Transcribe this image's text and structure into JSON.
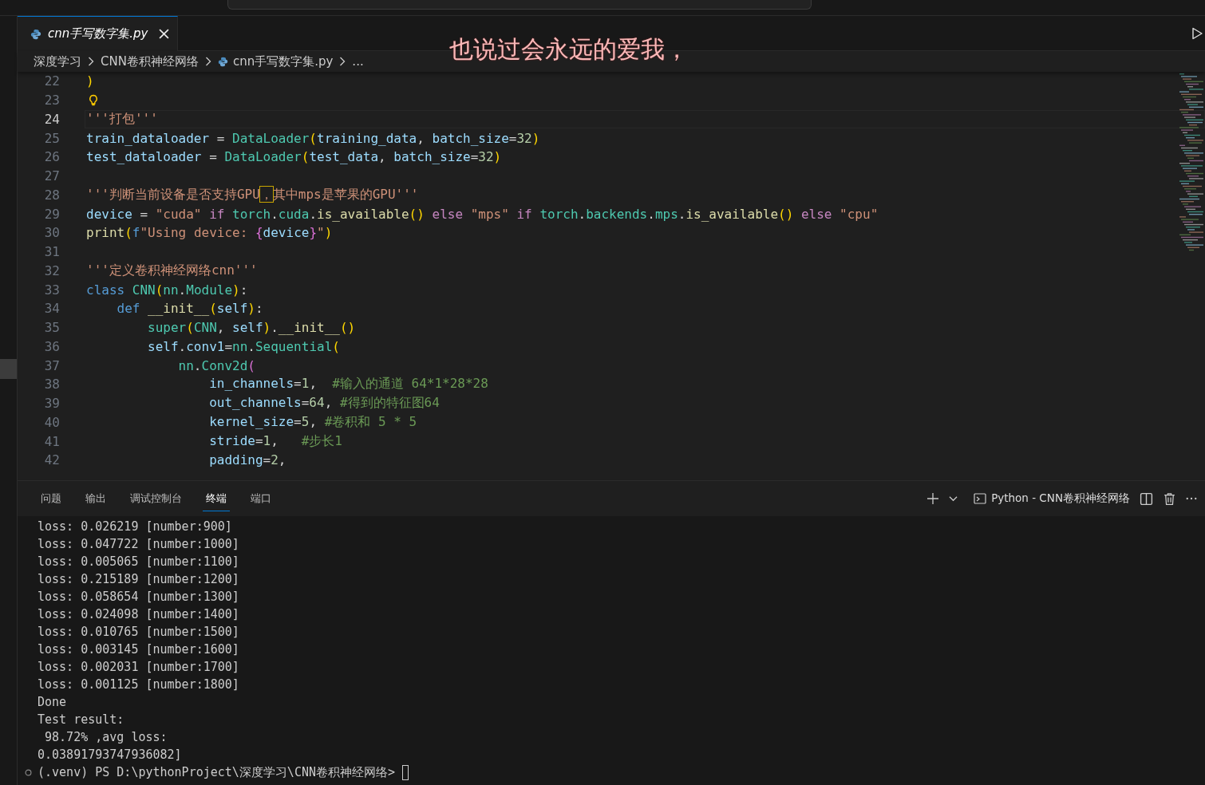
{
  "tab": {
    "label": "cnn手写数字集.py",
    "selected": true
  },
  "breadcrumb": [
    "深度学习",
    "CNN卷积神经网络",
    "cnn手写数字集.py",
    "..."
  ],
  "overlay_lyric": "也说过会永远的爱我，",
  "lines": [
    {
      "number": "22",
      "current": false,
      "tokens": [
        {
          "kind": "brk1",
          "text": ")"
        }
      ]
    },
    {
      "number": "23",
      "current": false,
      "tokens": [
        {
          "kind": "lightbulb"
        }
      ]
    },
    {
      "number": "24",
      "current": true,
      "tokens": [
        {
          "kind": "str",
          "text": "'''打包'''"
        }
      ]
    },
    {
      "number": "25",
      "current": false,
      "tokens": [
        {
          "kind": "var",
          "text": "train_dataloader"
        },
        {
          "kind": "plain",
          "text": " = "
        },
        {
          "kind": "cls",
          "text": "DataLoader"
        },
        {
          "kind": "brk1",
          "text": "("
        },
        {
          "kind": "var",
          "text": "training_data"
        },
        {
          "kind": "plain",
          "text": ", "
        },
        {
          "kind": "var",
          "text": "batch_size"
        },
        {
          "kind": "plain",
          "text": "="
        },
        {
          "kind": "num",
          "text": "32"
        },
        {
          "kind": "brk1",
          "text": ")"
        }
      ]
    },
    {
      "number": "26",
      "current": false,
      "tokens": [
        {
          "kind": "var",
          "text": "test_dataloader"
        },
        {
          "kind": "plain",
          "text": " = "
        },
        {
          "kind": "cls",
          "text": "DataLoader"
        },
        {
          "kind": "brk1",
          "text": "("
        },
        {
          "kind": "var",
          "text": "test_data"
        },
        {
          "kind": "plain",
          "text": ", "
        },
        {
          "kind": "var",
          "text": "batch_size"
        },
        {
          "kind": "plain",
          "text": "="
        },
        {
          "kind": "num",
          "text": "32"
        },
        {
          "kind": "brk1",
          "text": ")"
        }
      ]
    },
    {
      "number": "27",
      "current": false
    },
    {
      "number": "28",
      "current": false,
      "tokens": [
        {
          "kind": "str",
          "text": "'''判断当前设备是否支持GPU"
        },
        {
          "kind": "flagged",
          "text": "，"
        },
        {
          "kind": "str",
          "text": "其中mps是苹果的GPU'''"
        }
      ]
    },
    {
      "number": "29",
      "current": false,
      "tokens": [
        {
          "kind": "var",
          "text": "device"
        },
        {
          "kind": "plain",
          "text": " = "
        },
        {
          "kind": "str",
          "text": "\"cuda\""
        },
        {
          "kind": "ctrl",
          "text": " if "
        },
        {
          "kind": "cls",
          "text": "torch"
        },
        {
          "kind": "plain",
          "text": "."
        },
        {
          "kind": "cls",
          "text": "cuda"
        },
        {
          "kind": "plain",
          "text": "."
        },
        {
          "kind": "fn",
          "text": "is_available"
        },
        {
          "kind": "brk1",
          "text": "()"
        },
        {
          "kind": "ctrl",
          "text": " else "
        },
        {
          "kind": "str",
          "text": "\"mps\""
        },
        {
          "kind": "ctrl",
          "text": " if "
        },
        {
          "kind": "cls",
          "text": "torch"
        },
        {
          "kind": "plain",
          "text": "."
        },
        {
          "kind": "cls",
          "text": "backends"
        },
        {
          "kind": "plain",
          "text": "."
        },
        {
          "kind": "cls",
          "text": "mps"
        },
        {
          "kind": "plain",
          "text": "."
        },
        {
          "kind": "fn",
          "text": "is_available"
        },
        {
          "kind": "brk1",
          "text": "()"
        },
        {
          "kind": "ctrl",
          "text": " else "
        },
        {
          "kind": "str",
          "text": "\"cpu\""
        }
      ]
    },
    {
      "number": "30",
      "current": false,
      "tokens": [
        {
          "kind": "fn",
          "text": "print"
        },
        {
          "kind": "brk1",
          "text": "("
        },
        {
          "kind": "kw",
          "text": "f"
        },
        {
          "kind": "str",
          "text": "\"Using device: "
        },
        {
          "kind": "brk2",
          "text": "{"
        },
        {
          "kind": "var",
          "text": "device"
        },
        {
          "kind": "brk2",
          "text": "}"
        },
        {
          "kind": "str",
          "text": "\""
        },
        {
          "kind": "brk1",
          "text": ")"
        }
      ]
    },
    {
      "number": "31",
      "current": false
    },
    {
      "number": "32",
      "current": false,
      "tokens": [
        {
          "kind": "str",
          "text": "'''定义卷积神经网络cnn'''"
        }
      ]
    },
    {
      "number": "33",
      "current": false,
      "tokens": [
        {
          "kind": "kw",
          "text": "class "
        },
        {
          "kind": "cls",
          "text": "CNN"
        },
        {
          "kind": "brk1",
          "text": "("
        },
        {
          "kind": "cls",
          "text": "nn"
        },
        {
          "kind": "plain",
          "text": "."
        },
        {
          "kind": "cls",
          "text": "Module"
        },
        {
          "kind": "brk1",
          "text": ")"
        },
        {
          "kind": "plain",
          "text": ":"
        }
      ]
    },
    {
      "number": "34",
      "current": false,
      "tokens": [
        {
          "kind": "kw",
          "text": "    def "
        },
        {
          "kind": "fn",
          "text": "__init__"
        },
        {
          "kind": "brk1",
          "text": "("
        },
        {
          "kind": "var",
          "text": "self"
        },
        {
          "kind": "brk1",
          "text": ")"
        },
        {
          "kind": "plain",
          "text": ":"
        }
      ]
    },
    {
      "number": "35",
      "current": false,
      "tokens": [
        {
          "kind": "cls",
          "text": "        super"
        },
        {
          "kind": "brk1",
          "text": "("
        },
        {
          "kind": "cls",
          "text": "CNN"
        },
        {
          "kind": "plain",
          "text": ", "
        },
        {
          "kind": "var",
          "text": "self"
        },
        {
          "kind": "brk1",
          "text": ")"
        },
        {
          "kind": "plain",
          "text": "."
        },
        {
          "kind": "fn",
          "text": "__init__"
        },
        {
          "kind": "brk1",
          "text": "()"
        }
      ]
    },
    {
      "number": "36",
      "current": false,
      "tokens": [
        {
          "kind": "var",
          "text": "        self"
        },
        {
          "kind": "plain",
          "text": "."
        },
        {
          "kind": "var",
          "text": "conv1"
        },
        {
          "kind": "plain",
          "text": "="
        },
        {
          "kind": "cls",
          "text": "nn"
        },
        {
          "kind": "plain",
          "text": "."
        },
        {
          "kind": "cls",
          "text": "Sequential"
        },
        {
          "kind": "brk1",
          "text": "("
        }
      ]
    },
    {
      "number": "37",
      "current": false,
      "tokens": [
        {
          "kind": "cls",
          "text": "            nn"
        },
        {
          "kind": "plain",
          "text": "."
        },
        {
          "kind": "cls",
          "text": "Conv2d"
        },
        {
          "kind": "brk2",
          "text": "("
        }
      ]
    },
    {
      "number": "38",
      "current": false,
      "tokens": [
        {
          "kind": "var",
          "text": "                in_channels"
        },
        {
          "kind": "plain",
          "text": "="
        },
        {
          "kind": "num",
          "text": "1"
        },
        {
          "kind": "plain",
          "text": ",  "
        },
        {
          "kind": "comment",
          "text": "#输入的通道 64*1*28*28"
        }
      ]
    },
    {
      "number": "39",
      "current": false,
      "tokens": [
        {
          "kind": "var",
          "text": "                out_channels"
        },
        {
          "kind": "plain",
          "text": "="
        },
        {
          "kind": "num",
          "text": "64"
        },
        {
          "kind": "plain",
          "text": ", "
        },
        {
          "kind": "comment",
          "text": "#得到的特征图64"
        }
      ]
    },
    {
      "number": "40",
      "current": false,
      "tokens": [
        {
          "kind": "var",
          "text": "                kernel_size"
        },
        {
          "kind": "plain",
          "text": "="
        },
        {
          "kind": "num",
          "text": "5"
        },
        {
          "kind": "plain",
          "text": ", "
        },
        {
          "kind": "comment",
          "text": "#卷积和 5 * 5"
        }
      ]
    },
    {
      "number": "41",
      "current": false,
      "tokens": [
        {
          "kind": "var",
          "text": "                stride"
        },
        {
          "kind": "plain",
          "text": "="
        },
        {
          "kind": "num",
          "text": "1"
        },
        {
          "kind": "plain",
          "text": ",   "
        },
        {
          "kind": "comment",
          "text": "#步长1"
        }
      ]
    },
    {
      "number": "42",
      "current": false,
      "tokens": [
        {
          "kind": "var",
          "text": "                padding"
        },
        {
          "kind": "plain",
          "text": "="
        },
        {
          "kind": "num",
          "text": "2"
        },
        {
          "kind": "plain",
          "text": ","
        }
      ]
    }
  ],
  "panel": {
    "tabs": [
      {
        "label": "问题",
        "selected": false
      },
      {
        "label": "输出",
        "selected": false
      },
      {
        "label": "调试控制台",
        "selected": false
      },
      {
        "label": "终端",
        "selected": true
      },
      {
        "label": "端口",
        "selected": false
      }
    ],
    "terminal_name": "Python - CNN卷积神经网络",
    "output": [
      "loss: 0.026219 [number:900]",
      "loss: 0.047722 [number:1000]",
      "loss: 0.005065 [number:1100]",
      "loss: 0.215189 [number:1200]",
      "loss: 0.058654 [number:1300]",
      "loss: 0.024098 [number:1400]",
      "loss: 0.010765 [number:1500]",
      "loss: 0.003145 [number:1600]",
      "loss: 0.002031 [number:1700]",
      "loss: 0.001125 [number:1800]",
      "Done",
      "Test result:",
      " 98.72% ,avg loss:",
      "0.03891793747936082]"
    ],
    "prompt": "(.venv) PS D:\\pythonProject\\深度学习\\CNN卷积神经网络>"
  }
}
